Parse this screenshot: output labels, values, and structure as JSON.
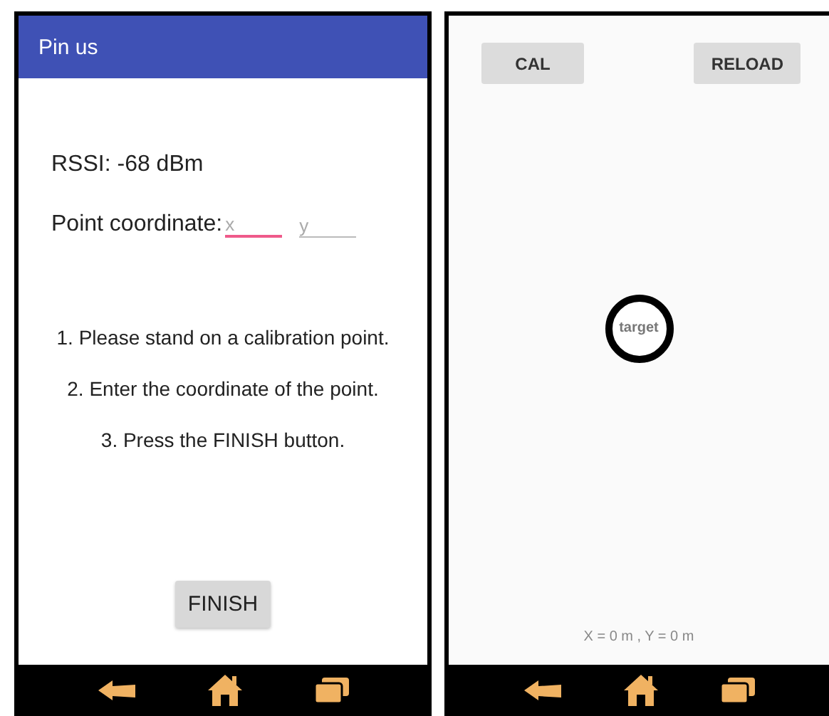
{
  "left_screen": {
    "app_bar": {
      "title": "Pin us"
    },
    "rssi": "RSSI: -68 dBm",
    "coordinate": {
      "label": "Point coordinate:",
      "fields": [
        {
          "placeholder": "x",
          "focused": true
        },
        {
          "placeholder": "y",
          "focused": false
        }
      ]
    },
    "instructions": [
      "1. Please stand on a calibration point.",
      "2. Enter the coordinate of the point.",
      "3. Press the FINISH button."
    ],
    "finish_button": "FINISH"
  },
  "right_screen": {
    "buttons": [
      "CAL",
      "RELOAD"
    ],
    "target": {
      "label": "target"
    },
    "position": "X = 0 m , Y = 0 m"
  }
}
